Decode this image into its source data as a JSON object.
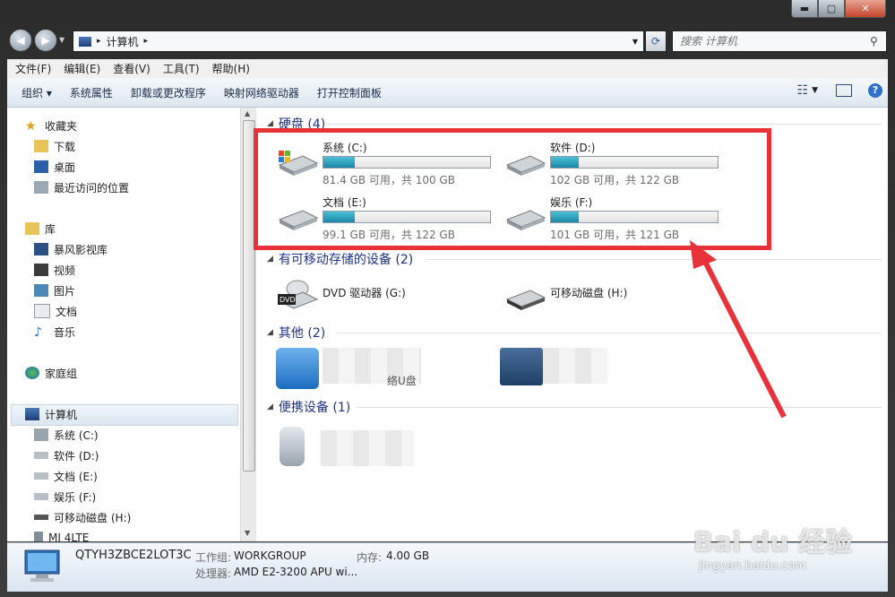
{
  "window": {
    "controls": {
      "minimize": "▬",
      "maximize": "▢",
      "close": "✕"
    }
  },
  "address": {
    "path": [
      "计算机"
    ],
    "search_placeholder": "搜索 计算机"
  },
  "menubar": [
    "文件(F)",
    "编辑(E)",
    "查看(V)",
    "工具(T)",
    "帮助(H)"
  ],
  "toolbar": [
    "组织 ▾",
    "系统属性",
    "卸载或更改程序",
    "映射网络驱动器",
    "打开控制面板"
  ],
  "nav": {
    "favorites": {
      "title": "收藏夹",
      "items": [
        "下载",
        "桌面",
        "最近访问的位置"
      ]
    },
    "libraries": {
      "title": "库",
      "items": [
        "暴风影视库",
        "视频",
        "图片",
        "文档",
        "音乐"
      ]
    },
    "homegroup": "家庭组",
    "computer": {
      "title": "计算机",
      "items": [
        "系统 (C:)",
        "软件 (D:)",
        "文档 (E:)",
        "娱乐 (F:)",
        "可移动磁盘 (H:)",
        "MI 4LTE"
      ]
    }
  },
  "groups": {
    "hard_drives": {
      "title": "硬盘 (4)",
      "drives": [
        {
          "name": "系统 (C:)",
          "size": "81.4 GB 可用，共 100 GB",
          "used": 0.186
        },
        {
          "name": "软件 (D:)",
          "size": "102 GB 可用，共 122 GB",
          "used": 0.164
        },
        {
          "name": "文档 (E:)",
          "size": "99.1 GB 可用，共 122 GB",
          "used": 0.188
        },
        {
          "name": "娱乐 (F:)",
          "size": "101 GB 可用，共 121 GB",
          "used": 0.165
        }
      ]
    },
    "removable": {
      "title": "有可移动存储的设备 (2)",
      "devices": [
        "DVD 驱动器 (G:)",
        "可移动磁盘 (H:)"
      ]
    },
    "other": {
      "title": "其他 (2)",
      "devices": [
        "络U盘"
      ]
    },
    "portable": {
      "title": "便携设备 (1)"
    }
  },
  "status": {
    "computer_name": "QTYH3ZBCE2LOT3C",
    "workgroup_label": "工作组:",
    "workgroup": "WORKGROUP",
    "memory_label": "内存:",
    "memory": "4.00 GB",
    "cpu_label": "处理器:",
    "cpu": "AMD E2-3200 APU wi..."
  },
  "watermark": {
    "main": "Bai du 经验",
    "sub": "jingyan.baidu.com"
  },
  "colors": {
    "accent_red": "#e8323a",
    "bar_fill": "#1b86a6",
    "group_title": "#1e3287"
  }
}
